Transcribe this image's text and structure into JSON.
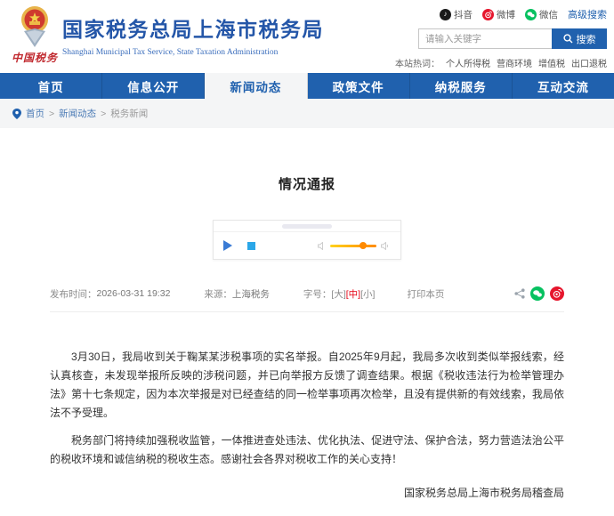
{
  "header": {
    "site_title": "国家税务总局上海市税务局",
    "site_subtitle": "Shanghai Municipal Tax Service, State Taxation Administration",
    "logo_caption": "中国税务",
    "social": {
      "douyin": "抖音",
      "weibo": "微博",
      "wechat": "微信",
      "advanced_search": "高级搜索"
    },
    "search": {
      "placeholder": "请输入关键字",
      "button": "搜索"
    },
    "hotwords": {
      "label": "本站热词：",
      "items": [
        "个人所得税",
        "营商环境",
        "增值税",
        "出口退税"
      ]
    }
  },
  "nav": {
    "items": [
      {
        "label": "首页",
        "active": false
      },
      {
        "label": "信息公开",
        "active": false
      },
      {
        "label": "新闻动态",
        "active": true
      },
      {
        "label": "政策文件",
        "active": false
      },
      {
        "label": "纳税服务",
        "active": false
      },
      {
        "label": "互动交流",
        "active": false
      }
    ]
  },
  "breadcrumb": {
    "items": [
      "首页",
      "新闻动态",
      "税务新闻"
    ],
    "separator": ">"
  },
  "article": {
    "title": "情况通报",
    "meta": {
      "publish_label": "发布时间：",
      "publish_time": "2026-03-31 19:32",
      "source_label": "来源：",
      "source": "上海税务",
      "fontsize_label": "字号：",
      "fontsize_options": [
        "[大]",
        "[中]",
        "[小]"
      ],
      "print": "打印本页"
    },
    "paragraphs": [
      "3月30日，我局收到关于鞠某某涉税事项的实名举报。自2025年9月起，我局多次收到类似举报线索，经认真核查，未发现举报所反映的涉税问题，并已向举报方反馈了调查结果。根据《税收违法行为检举管理办法》第十七条规定，因为本次举报是对已经查结的同一检举事项再次检举，且没有提供新的有效线索，我局依法不予受理。",
      "税务部门将持续加强税收监管，一体推进查处违法、优化执法、促进守法、保护合法，努力营造法治公平的税收环境和诚信纳税的税收生态。感谢社会各界对税收工作的关心支持！"
    ],
    "signature": "国家税务总局上海市税务局稽查局"
  },
  "colors": {
    "brand_blue": "#2061ae",
    "title_blue": "#2456a8",
    "logo_red": "#c0272d",
    "active_fontsize_red": "#e60012",
    "wechat_green": "#07c160",
    "weibo_red": "#e6162d",
    "douyin_black": "#1a1a1a",
    "volume_orange": "#ff8a00",
    "breadcrumb_bg": "#f4f5f6"
  }
}
